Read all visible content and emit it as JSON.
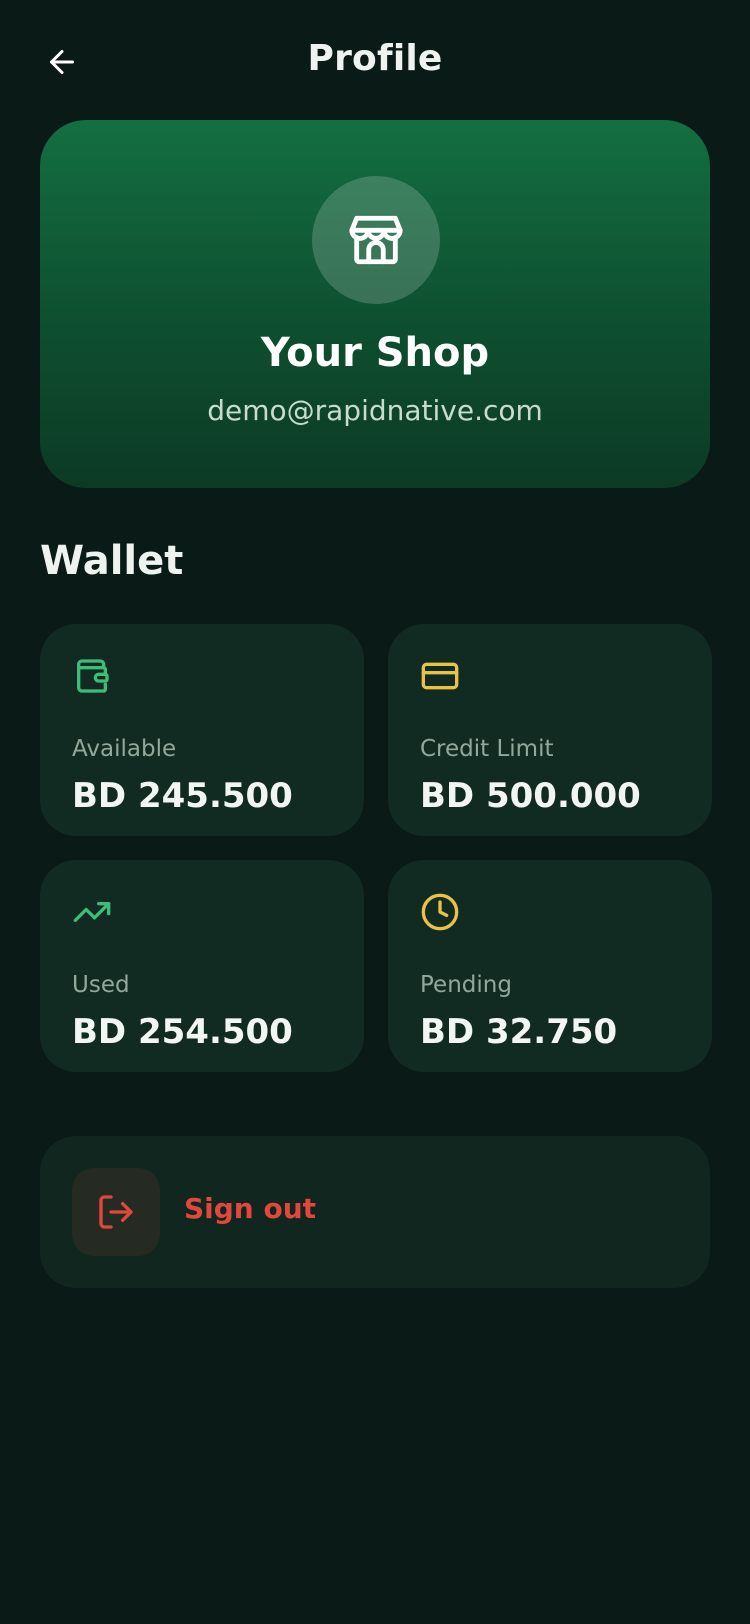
{
  "header": {
    "title": "Profile",
    "back_icon": "arrow-left-icon"
  },
  "profile": {
    "avatar_icon": "store-icon",
    "shop_name": "Your Shop",
    "email": "demo@rapidnative.com"
  },
  "wallet": {
    "title": "Wallet",
    "cards": [
      {
        "icon": "wallet-icon",
        "label": "Available",
        "value": "BD 245.500",
        "color": "#3dbd78"
      },
      {
        "icon": "credit-card-icon",
        "label": "Credit Limit",
        "value": "BD 500.000",
        "color": "#e9c243"
      },
      {
        "icon": "trending-up-icon",
        "label": "Used",
        "value": "BD 254.500",
        "color": "#3dbd78"
      },
      {
        "icon": "clock-icon",
        "label": "Pending",
        "value": "BD 32.750",
        "color": "#e9c243"
      }
    ]
  },
  "actions": {
    "signout_label": "Sign out",
    "signout_icon": "log-out-icon",
    "signout_color": "#e0473d"
  },
  "colors": {
    "background": "#0a1a16",
    "card": "#122b22",
    "accent_green": "#136f41"
  }
}
